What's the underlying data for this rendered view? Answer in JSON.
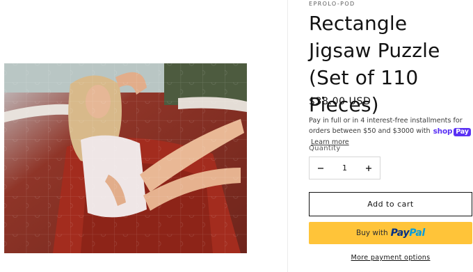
{
  "product": {
    "vendor": "EPROLO-POD",
    "title": "Rectangle Jigsaw Puzzle (Set of 110 Pieces)",
    "price": "$38.00 USD",
    "installments": {
      "text": "Pay in full or in 4 interest-free installments for orders between $50 and $3000 with",
      "shoppay_prefix": "shop",
      "shoppay_suffix": "Pay",
      "learn_more": "Learn more"
    },
    "quantity": {
      "label": "Quantity",
      "value": "1",
      "decrement_icon": "minus-icon",
      "increment_icon": "plus-icon"
    },
    "buttons": {
      "add_to_cart": "Add to cart",
      "paypal_prefix": "Buy with",
      "paypal_logo_part1": "Pay",
      "paypal_logo_part2": "Pal",
      "more_payment_options": "More payment options"
    }
  },
  "colors": {
    "paypal_yellow": "#ffc439",
    "shoppay_purple": "#5a31f4",
    "text": "#121212"
  }
}
